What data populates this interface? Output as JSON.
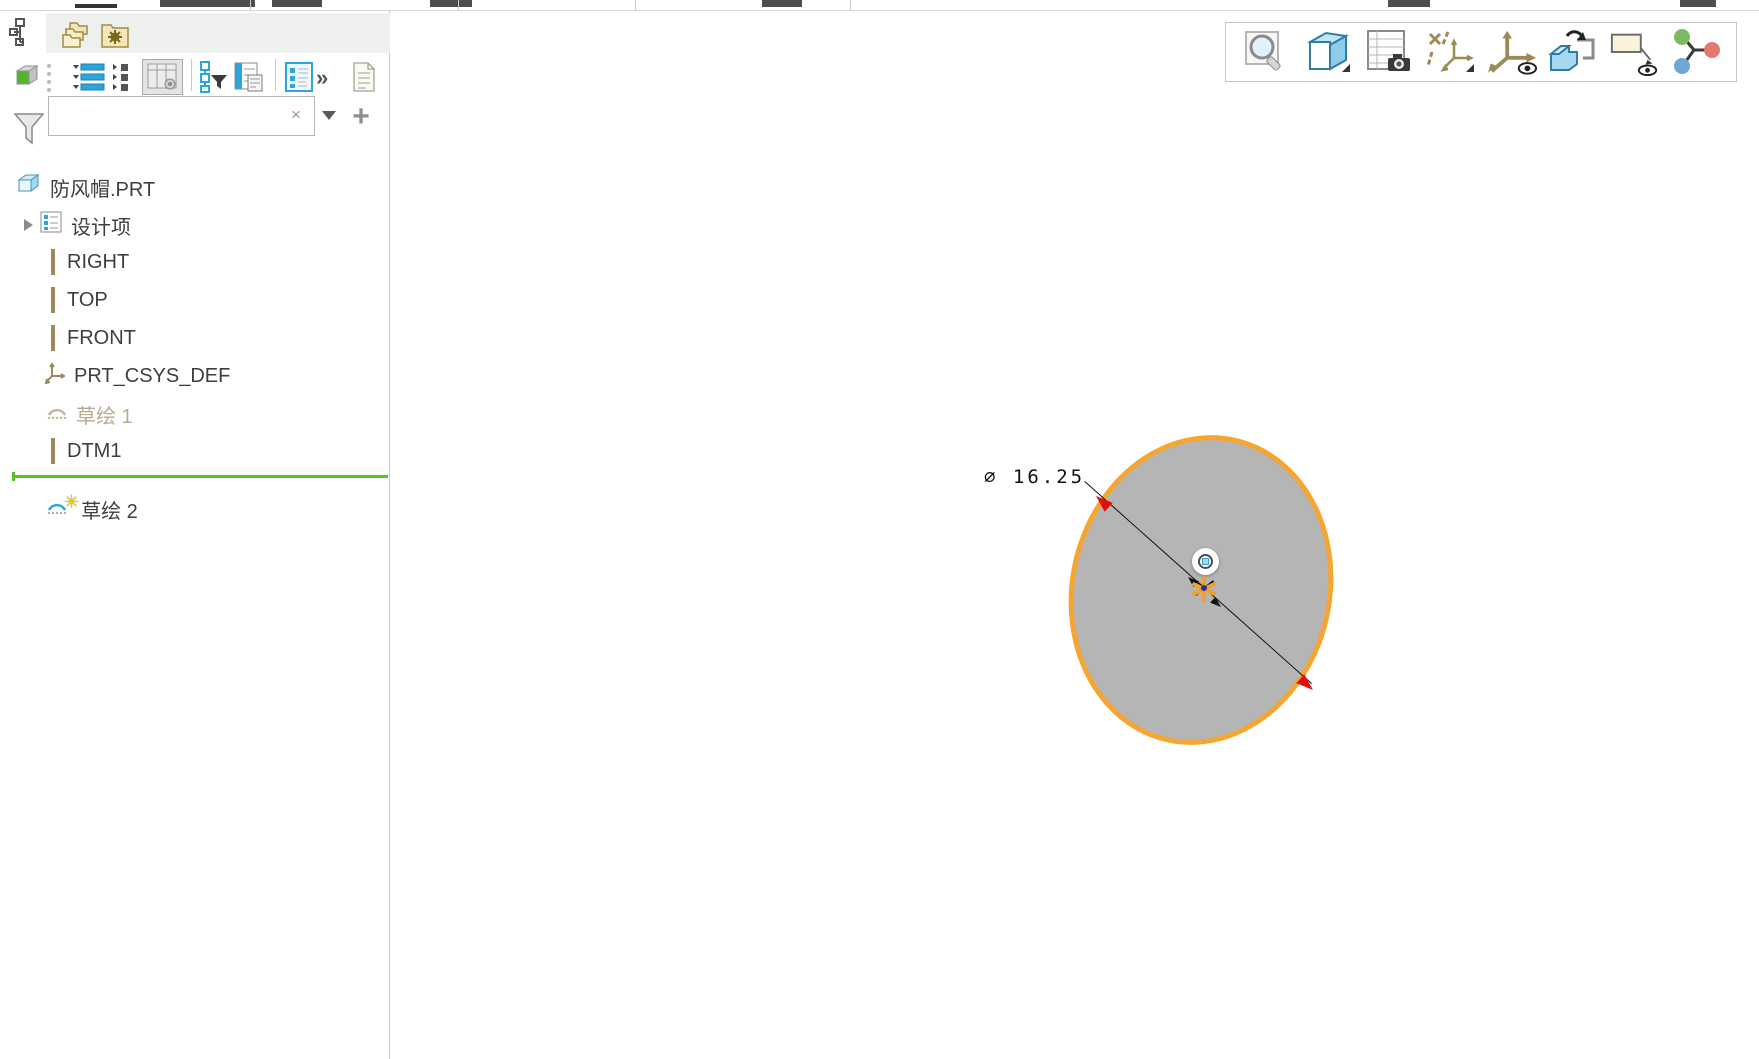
{
  "navigator": {
    "tabs": [
      {
        "icon": "model-tree-icon"
      },
      {
        "icon": "folder-browser-icon"
      },
      {
        "icon": "favorites-icon"
      }
    ],
    "toolbar": {
      "icons": [
        "show-cube",
        "expand-all",
        "collapse-all",
        "tree-columns-pressed",
        "tree-filters",
        "tree-columns-settings",
        "settings-list",
        "overflow-chevron",
        "document"
      ],
      "overflow_glyph": "»"
    },
    "search": {
      "value": "",
      "placeholder": "",
      "clear_glyph": "×",
      "add_glyph": "+"
    },
    "tree": {
      "root": {
        "label": "防风帽.PRT",
        "icon": "part-icon"
      },
      "items": [
        {
          "label": "设计项",
          "icon": "design-items-icon",
          "expandable": true
        },
        {
          "label": "RIGHT",
          "icon": "datum-plane-icon"
        },
        {
          "label": "TOP",
          "icon": "datum-plane-icon"
        },
        {
          "label": "FRONT",
          "icon": "datum-plane-icon"
        },
        {
          "label": "PRT_CSYS_DEF",
          "icon": "csys-icon"
        },
        {
          "label": "草绘 1",
          "icon": "sketch-icon",
          "muted": true
        },
        {
          "label": "DTM1",
          "icon": "datum-plane-icon"
        },
        {
          "label": "草绘 2",
          "icon": "sketch-icon",
          "new": true,
          "new_marker": "✳"
        }
      ],
      "insertion_indicator_color": "#58c322"
    }
  },
  "graphics_toolbar": {
    "icons": [
      "zoom",
      "saved-orientations",
      "view-manager",
      "datum-display-filters",
      "spin-center",
      "view-orientation",
      "annotation-display",
      "node-graph"
    ]
  },
  "viewport": {
    "dimension": {
      "text": "∅ 16.25",
      "prefix": "∅",
      "value": "16.25"
    },
    "sketch_entity": "circle",
    "colors": {
      "circle_fill": "#b5b5b5",
      "circle_highlight": "#f5a630",
      "dimension_arrow": "#e01010",
      "center_star": "#f0a030",
      "center_dot": "#283593"
    }
  }
}
